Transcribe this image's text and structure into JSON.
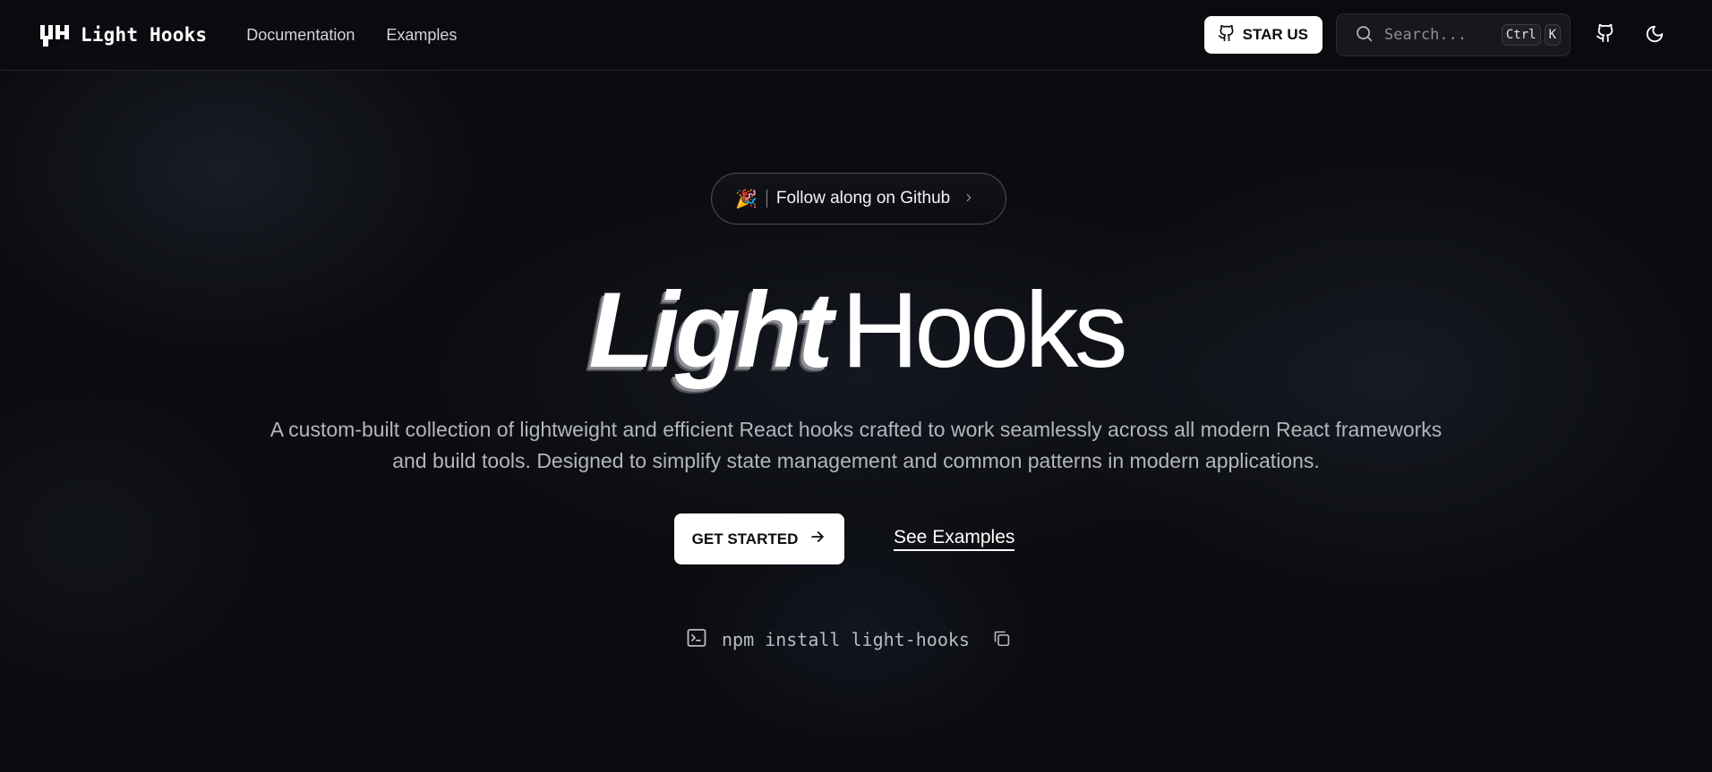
{
  "nav": {
    "brand": "Light Hooks",
    "links": [
      "Documentation",
      "Examples"
    ],
    "star_label": "STAR US",
    "search_placeholder": "Search...",
    "shortcut_keys": [
      "Ctrl",
      "K"
    ],
    "icons": [
      "github-icon",
      "moon-icon"
    ]
  },
  "hero": {
    "badge_emoji": "🎉",
    "badge_text": "Follow along on Github",
    "title_italic": "Light",
    "title_regular": "Hooks",
    "subtitle_line1": "A custom-built collection of lightweight and efficient React hooks crafted to work seamlessly across all modern React frameworks",
    "subtitle_line2": "and build tools. Designed to simplify state management and common patterns in modern applications.",
    "primary_cta": "GET STARTED",
    "secondary_cta": "See Examples",
    "install_command": "npm install light-hooks"
  },
  "colors": {
    "background": "#0b0c0f",
    "button_bg": "#ffffff",
    "muted_text": "#b3b6bc"
  }
}
